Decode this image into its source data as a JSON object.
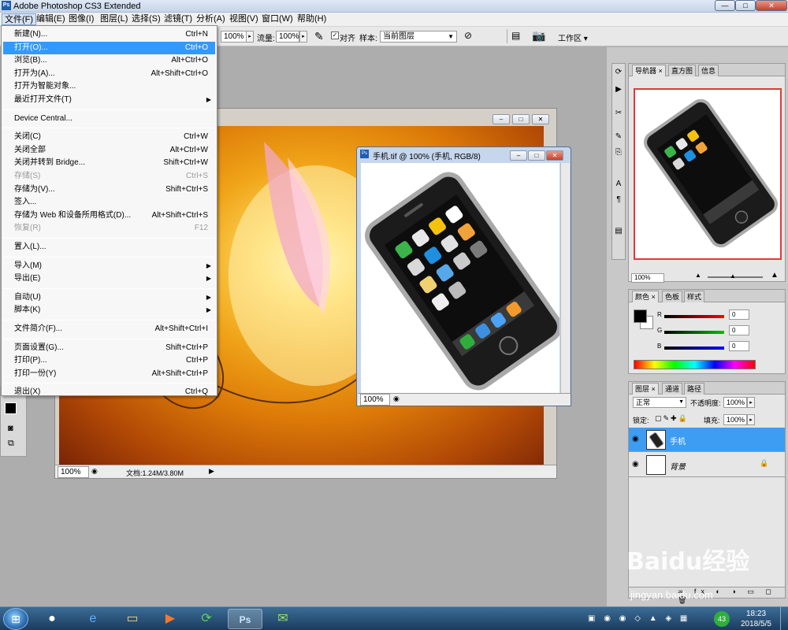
{
  "title_bar": {
    "app_icon": "Ps",
    "title": "Adobe Photoshop CS3 Extended",
    "minimize": "—",
    "maximize": "□",
    "close": "✕"
  },
  "menu_bar": [
    "文件(F)",
    "编辑(E)",
    "图像(I)",
    "图层(L)",
    "选择(S)",
    "滤镜(T)",
    "分析(A)",
    "视图(V)",
    "窗口(W)",
    "帮助(H)"
  ],
  "options_bar": {
    "zoom_value": "100%",
    "flow_label": "流量:",
    "flow_value": "100%",
    "align_label": "对齐",
    "sample_label": "样本:",
    "sample_value": "当前图层",
    "workspace_label": "工作区 ▾"
  },
  "file_menu": {
    "items": [
      {
        "label": "新建(N)...",
        "shortcut": "Ctrl+N"
      },
      {
        "label": "打开(O)...",
        "shortcut": "Ctrl+O",
        "highlighted": true
      },
      {
        "label": "浏览(B)...",
        "shortcut": "Alt+Ctrl+O"
      },
      {
        "label": "打开为(A)...",
        "shortcut": "Alt+Shift+Ctrl+O"
      },
      {
        "label": "打开为智能对象...",
        "shortcut": ""
      },
      {
        "label": "最近打开文件(T)",
        "shortcut": "",
        "submenu": true
      },
      {
        "separator": true
      },
      {
        "label": "Device Central...",
        "shortcut": ""
      },
      {
        "separator": true
      },
      {
        "label": "关闭(C)",
        "shortcut": "Ctrl+W"
      },
      {
        "label": "关闭全部",
        "shortcut": "Alt+Ctrl+W"
      },
      {
        "label": "关闭并转到 Bridge...",
        "shortcut": "Shift+Ctrl+W"
      },
      {
        "label": "存储(S)",
        "shortcut": "Ctrl+S",
        "disabled": true
      },
      {
        "label": "存储为(V)...",
        "shortcut": "Shift+Ctrl+S"
      },
      {
        "label": "签入...",
        "shortcut": ""
      },
      {
        "label": "存储为 Web 和设备所用格式(D)...",
        "shortcut": "Alt+Shift+Ctrl+S"
      },
      {
        "label": "恢复(R)",
        "shortcut": "F12",
        "disabled": true
      },
      {
        "separator": true
      },
      {
        "label": "置入(L)...",
        "shortcut": ""
      },
      {
        "separator": true
      },
      {
        "label": "导入(M)",
        "shortcut": "",
        "submenu": true
      },
      {
        "label": "导出(E)",
        "shortcut": "",
        "submenu": true
      },
      {
        "separator": true
      },
      {
        "label": "自动(U)",
        "shortcut": "",
        "submenu": true
      },
      {
        "label": "脚本(K)",
        "shortcut": "",
        "submenu": true
      },
      {
        "separator": true
      },
      {
        "label": "文件简介(F)...",
        "shortcut": "Alt+Shift+Ctrl+I"
      },
      {
        "separator": true
      },
      {
        "label": "页面设置(G)...",
        "shortcut": "Shift+Ctrl+P"
      },
      {
        "label": "打印(P)...",
        "shortcut": "Ctrl+P"
      },
      {
        "label": "打印一份(Y)",
        "shortcut": "Alt+Shift+Ctrl+P"
      },
      {
        "separator": true
      },
      {
        "label": "退出(X)",
        "shortcut": "Ctrl+Q"
      }
    ]
  },
  "doc_background": {
    "zoom": "100%",
    "doc_info": "文档:1.24M/3.80M"
  },
  "doc_phone": {
    "title": "手机.tif @ 100% (手机, RGB/8)",
    "zoom": "100%"
  },
  "navigator_panel": {
    "tabs": [
      "导航器",
      "直方图",
      "信息"
    ],
    "zoom": "100%"
  },
  "color_panel": {
    "tabs": [
      "颜色",
      "色板",
      "样式"
    ],
    "channels": [
      {
        "name": "R",
        "value": "0"
      },
      {
        "name": "G",
        "value": "0"
      },
      {
        "name": "B",
        "value": "0"
      }
    ]
  },
  "layers_panel": {
    "tabs": [
      "图层",
      "通道",
      "路径"
    ],
    "blend_mode": "正常",
    "opacity_label": "不透明度:",
    "opacity_value": "100%",
    "lock_label": "锁定:",
    "fill_label": "填充:",
    "fill_value": "100%",
    "layers": [
      {
        "name": "手机",
        "selected": true
      },
      {
        "name": "背景",
        "selected": false,
        "locked": true
      }
    ]
  },
  "taskbar": {
    "time": "18:23",
    "date": "2018/5/5",
    "tray_badge": "43"
  },
  "colors": {
    "selection_blue": "#3399ff",
    "layer_selected": "#3d9df3"
  },
  "watermark": {
    "text": "Baidu经验",
    "url": "jingyan.baidu.com"
  }
}
